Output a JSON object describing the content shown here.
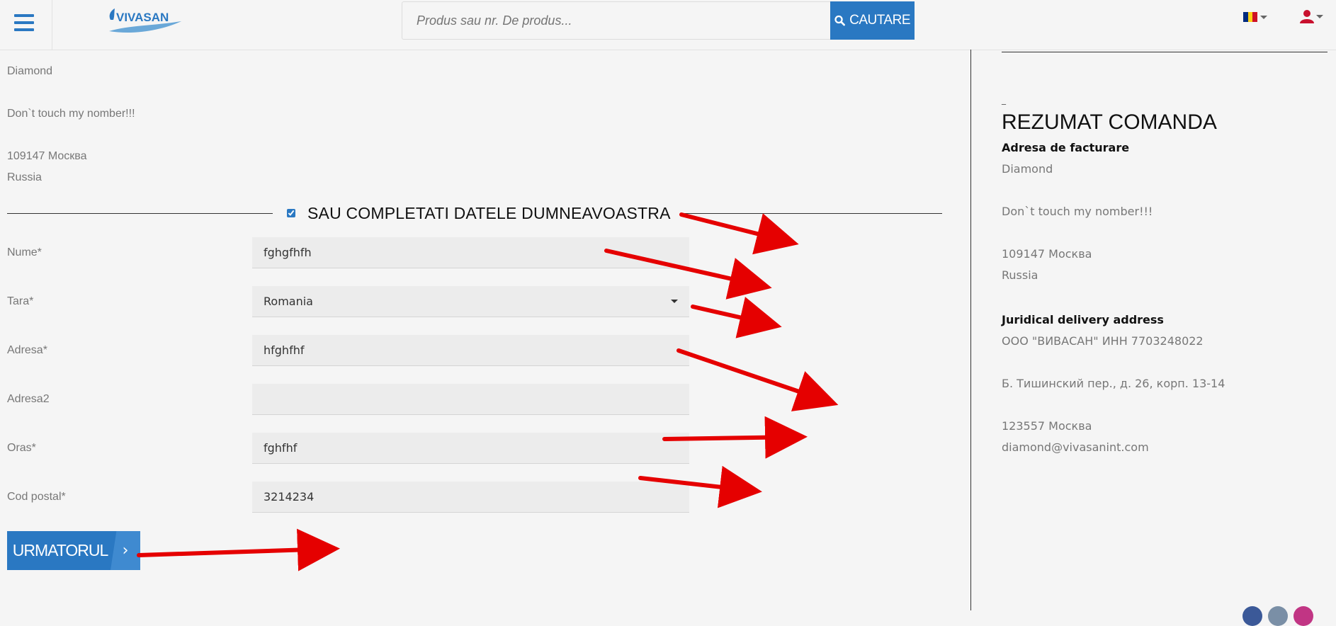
{
  "header": {
    "brand": "VIVASAN",
    "search_placeholder": "Produs sau nr. De produs...",
    "search_label": "CAUTARE",
    "language_flag": "romania-flag"
  },
  "saved_address": {
    "name": "Diamond",
    "note": "Don`t touch my nomber!!!",
    "city_line": "109147 Москва",
    "country": "Russia"
  },
  "section_title": "SAU COMPLETATI DATELE DUMNEAVOASTRA",
  "form": {
    "nume": {
      "label": "Nume*",
      "value": "fghgfhfh"
    },
    "tara": {
      "label": "Tara*",
      "value": "Romania"
    },
    "adresa": {
      "label": "Adresa*",
      "value": "hfghfhf"
    },
    "adresa2": {
      "label": "Adresa2",
      "value": ""
    },
    "oras": {
      "label": "Oras*",
      "value": "fghfhf"
    },
    "cod_postal": {
      "label": "Cod postal*",
      "value": "3214234"
    }
  },
  "next_label": "URMATORUL",
  "next_arrow": "›",
  "summary": {
    "dash": "_",
    "title": "REZUMAT COMANDA",
    "billing_heading": "Adresa de facturare",
    "billing": {
      "name": "Diamond",
      "note": "Don`t touch my nomber!!!",
      "city_line": "109147 Москва",
      "country": "Russia"
    },
    "delivery_heading": "Juridical delivery address",
    "delivery": {
      "company": "ООО \"ВИВАСАН\" ИНН 7703248022",
      "street": "Б. Тишинский пер., д. 26, корп. 13-14",
      "city_line": "123557 Москва",
      "email": "diamond@vivasanint.com"
    }
  },
  "colors": {
    "brand_blue": "#2a78c2",
    "annotation_red": "#e50000"
  }
}
